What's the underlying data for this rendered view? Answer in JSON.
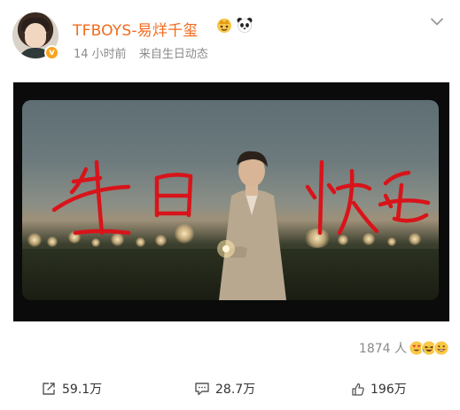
{
  "post": {
    "username": "TFBOYS-易烊千玺",
    "verified_badge": "v",
    "timestamp": "14 小时前",
    "source": "来自生日动态",
    "name_icons": [
      "crown-icon",
      "panda-icon"
    ],
    "menu_icon": "chevron-down-icon"
  },
  "media": {
    "description_icon": "photo",
    "handwriting_color": "#d8141a"
  },
  "reactions": {
    "count": "1874 人",
    "emojis": [
      "heart-eyes-emoji",
      "laughing-emoji",
      "grin-emoji"
    ]
  },
  "actions": {
    "repost": {
      "icon": "repost-icon",
      "count": "59.1万"
    },
    "comment": {
      "icon": "comment-icon",
      "count": "28.7万"
    },
    "like": {
      "icon": "thumbs-up-icon",
      "count": "196万"
    }
  },
  "colors": {
    "username": "#f26b1c",
    "meta": "#8a8a8a",
    "badge": "#f8a51c"
  }
}
